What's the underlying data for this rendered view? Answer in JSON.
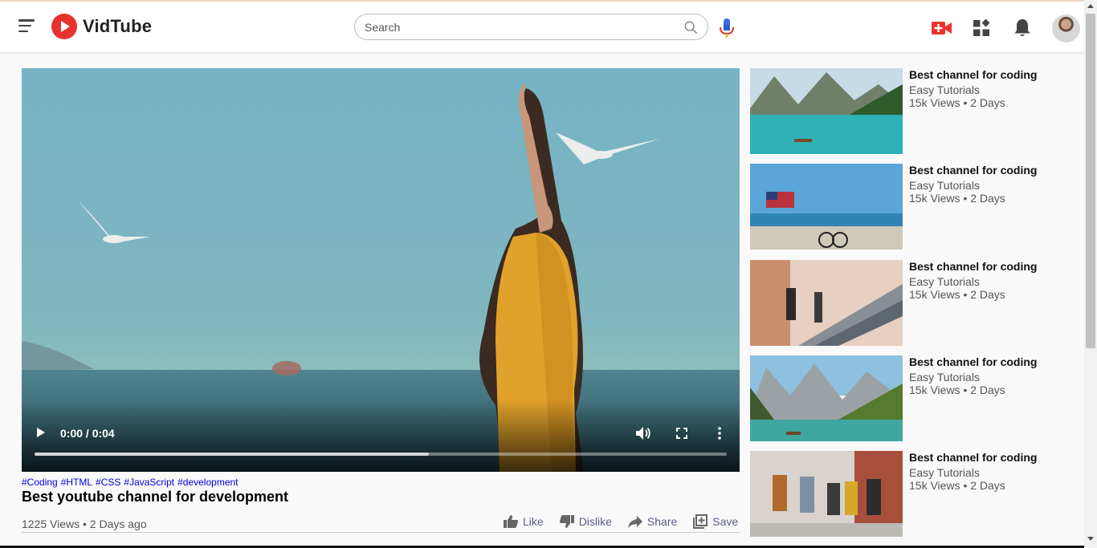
{
  "header": {
    "logo_text": "VidTube",
    "search_placeholder": "Search"
  },
  "player": {
    "time": "0:00 / 0:04",
    "progress": 0.57
  },
  "video": {
    "tags": [
      "#Coding",
      "#HTML",
      "#CSS",
      "#JavaScript",
      "#development"
    ],
    "title": "Best youtube channel for development",
    "stats": "1225 Views • 2 Days ago",
    "actions": {
      "like": "Like",
      "dislike": "Dislike",
      "share": "Share",
      "save": "Save"
    }
  },
  "sidebar": {
    "items": [
      {
        "title": "Best channel for coding",
        "channel": "Easy Tutorials",
        "meta": "15k Views • 2 Days"
      },
      {
        "title": "Best channel for coding",
        "channel": "Easy Tutorials",
        "meta": "15k Views • 2 Days"
      },
      {
        "title": "Best channel for coding",
        "channel": "Easy Tutorials",
        "meta": "15k Views • 2 Days"
      },
      {
        "title": "Best channel for coding",
        "channel": "Easy Tutorials",
        "meta": "15k Views • 2 Days"
      },
      {
        "title": "Best channel for coding",
        "channel": "Easy Tutorials",
        "meta": "15k Views • 2 Days"
      }
    ]
  },
  "colors": {
    "brand": "#e8322f",
    "tag_link": "#0000dd",
    "action_text": "#5a5a8a"
  },
  "icons": [
    "menu-icon",
    "logo-play-icon",
    "search-icon",
    "mic-icon",
    "upload-video-icon",
    "apps-icon",
    "bell-icon",
    "play-icon",
    "volume-icon",
    "fullscreen-icon",
    "more-vertical-icon",
    "thumbs-up-icon",
    "thumbs-down-icon",
    "share-icon",
    "save-playlist-icon"
  ]
}
